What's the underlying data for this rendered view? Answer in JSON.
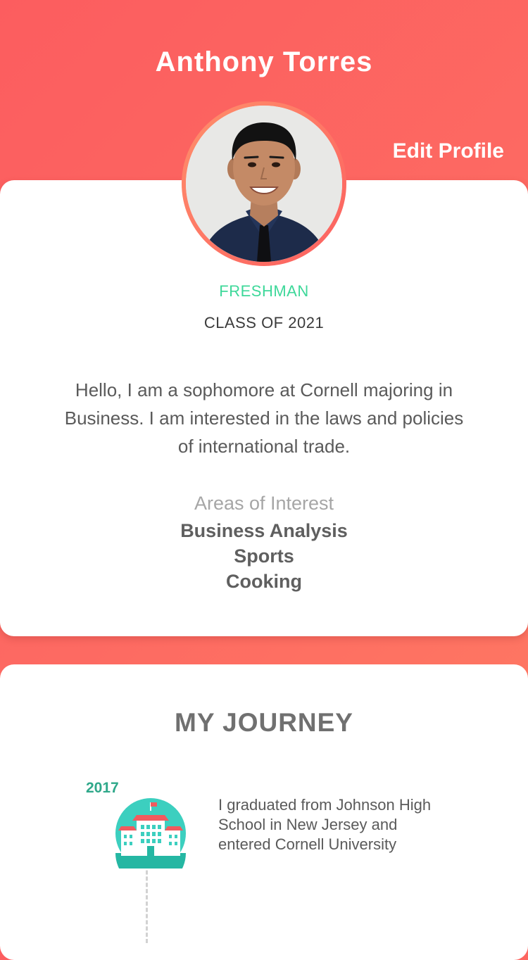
{
  "profile": {
    "name": "Anthony Torres",
    "edit_label": "Edit Profile",
    "year_level": "FRESHMAN",
    "class_of": "CLASS OF 2021",
    "bio": "Hello, I am a sophomore at Cornell majoring in Business. I am interested in the laws and policies of international trade.",
    "interests_heading": "Areas of Interest",
    "interests": [
      "Business Analysis",
      "Sports",
      "Cooking"
    ]
  },
  "journey": {
    "title": "MY JOURNEY",
    "entries": [
      {
        "year": "2017",
        "icon": "school-building-icon",
        "text": "I graduated from Johnson High School in New Jersey and entered Cornell University"
      }
    ]
  },
  "colors": {
    "header_gradient_start": "#fc5d5f",
    "header_gradient_end": "#ff7c63",
    "year_level": "#3ed89a",
    "timeline_year": "#2fa88a",
    "icon_circle": "#3ccfbf"
  }
}
